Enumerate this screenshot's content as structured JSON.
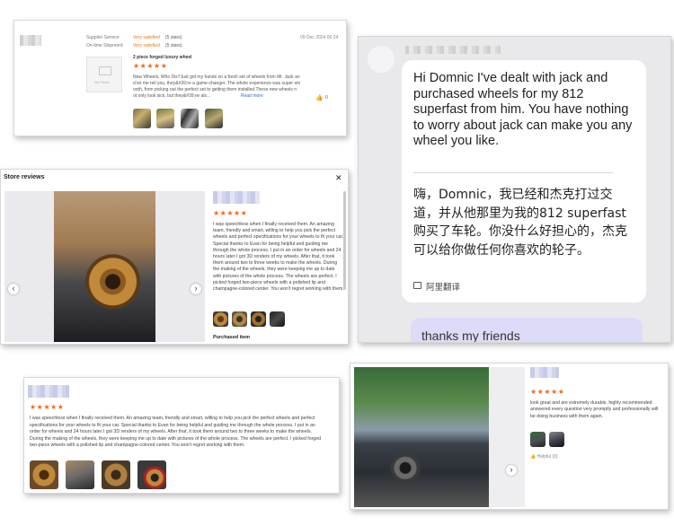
{
  "card1": {
    "supplier_service_label": "Supplier Service:",
    "supplier_service_value": "Very satisfied",
    "supplier_service_stars": "(5 stars)",
    "ontime_label": "On-time Shipment:",
    "ontime_value": "Very satisfied",
    "ontime_stars": "(5 stars)",
    "date": "09 Dec 2024 00:24",
    "no_photo": "No Photo",
    "product": "2 piece forged luxury wheel",
    "stars": "★★★★★",
    "review_l1": "New Wheels, Who Dis?Just got my hands on a fresh set of wheels from Mr. Jack an",
    "review_l2": "d let me tell you, they&#39;re a game-changer. The whole experience was super sm",
    "review_l3": "ooth, from picking out the perfect set to getting them installed.These new wheels n",
    "review_l4": "ot only look sick, but they&#39;ve als...",
    "read_more": "Read more",
    "likes": "0"
  },
  "card2": {
    "title": "Store reviews",
    "stars": "★★★★★",
    "review": "I was speechless when I finally received them. An amazing team, friendly and smart, willing to help you pick the perfect wheels and perfect specifications for your wheels to fit your car. Special thanks to Evan for being helpful and guiding me through the whole process. I put in an order for wheels and 24 hours later I got 3D renders of my wheels. After that, it took them around two to three weeks to make the wheels. During the making of the wheels, they were keeping me up to date with pictures of the whole process. The wheels are perfect. I picked forged two-piece wheels with a polished lip and champagne-colored center. You won't regret working with them.",
    "purchased": "Purchased item",
    "close": "✕",
    "prev": "‹",
    "next": "›"
  },
  "card3": {
    "message_en": "Hi Domnic I've dealt with jack and purchased wheels for my 812 superfast from him. You have  nothing to worry about jack can make you any wheel you like.",
    "message_zh": "嗨，Domnic，我已经和杰克打过交道，并从他那里为我的812 superfast购买了车轮。你没什么好担心的，杰克可以给你做任何你喜欢的轮子。",
    "translate_label": "阿里翻译",
    "reply": "thanks my friends"
  },
  "card4": {
    "stars": "★★★★★",
    "review": "I was speechless when I finally received them. An amazing team, friendly and smart, willing to help you pick the perfect wheels and perfect specifications for your wheels to fit your car. Special thanks to Evan for being helpful and guiding me through the whole process. I put in an order for wheels and 24 hours later I got 3D renders of my wheels. After that, it took them around two to three weeks to make the wheels. During the making of the wheels, they were keeping me up to date with pictures of the whole process. The wheels are perfect. I picked forged two-piece wheels with a polished lip and champagne-colored center. You won't regret working with them."
  },
  "card5": {
    "stars": "★★★★★",
    "review": "look great and are extremely durable. highly recommended answered every question very promptly and professionally will be doing business with them again.",
    "helpful": "Helpful (0)",
    "next": "›"
  },
  "colors": {
    "star": "#f26a1b",
    "link": "#2f6fd1",
    "accent": "#e07b1a"
  }
}
